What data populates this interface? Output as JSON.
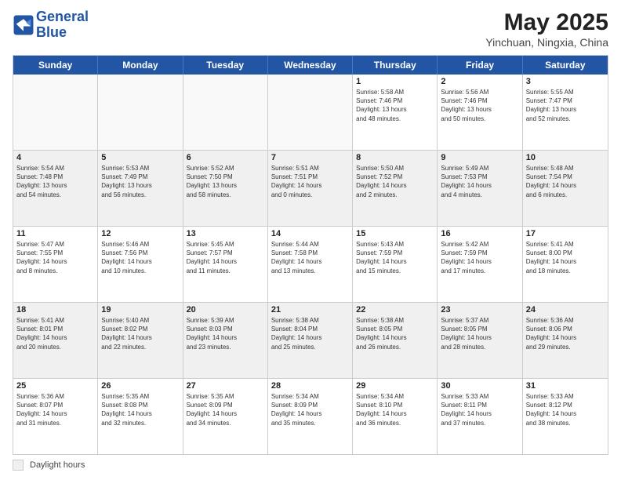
{
  "header": {
    "logo_line1": "General",
    "logo_line2": "Blue",
    "title": "May 2025",
    "subtitle": "Yinchuan, Ningxia, China"
  },
  "weekdays": [
    "Sunday",
    "Monday",
    "Tuesday",
    "Wednesday",
    "Thursday",
    "Friday",
    "Saturday"
  ],
  "legend": {
    "box_label": "Daylight hours"
  },
  "weeks": [
    [
      {
        "day": "",
        "info": "",
        "empty": true
      },
      {
        "day": "",
        "info": "",
        "empty": true
      },
      {
        "day": "",
        "info": "",
        "empty": true
      },
      {
        "day": "",
        "info": "",
        "empty": true
      },
      {
        "day": "1",
        "info": "Sunrise: 5:58 AM\nSunset: 7:46 PM\nDaylight: 13 hours\nand 48 minutes.",
        "empty": false
      },
      {
        "day": "2",
        "info": "Sunrise: 5:56 AM\nSunset: 7:46 PM\nDaylight: 13 hours\nand 50 minutes.",
        "empty": false
      },
      {
        "day": "3",
        "info": "Sunrise: 5:55 AM\nSunset: 7:47 PM\nDaylight: 13 hours\nand 52 minutes.",
        "empty": false
      }
    ],
    [
      {
        "day": "4",
        "info": "Sunrise: 5:54 AM\nSunset: 7:48 PM\nDaylight: 13 hours\nand 54 minutes.",
        "empty": false
      },
      {
        "day": "5",
        "info": "Sunrise: 5:53 AM\nSunset: 7:49 PM\nDaylight: 13 hours\nand 56 minutes.",
        "empty": false
      },
      {
        "day": "6",
        "info": "Sunrise: 5:52 AM\nSunset: 7:50 PM\nDaylight: 13 hours\nand 58 minutes.",
        "empty": false
      },
      {
        "day": "7",
        "info": "Sunrise: 5:51 AM\nSunset: 7:51 PM\nDaylight: 14 hours\nand 0 minutes.",
        "empty": false
      },
      {
        "day": "8",
        "info": "Sunrise: 5:50 AM\nSunset: 7:52 PM\nDaylight: 14 hours\nand 2 minutes.",
        "empty": false
      },
      {
        "day": "9",
        "info": "Sunrise: 5:49 AM\nSunset: 7:53 PM\nDaylight: 14 hours\nand 4 minutes.",
        "empty": false
      },
      {
        "day": "10",
        "info": "Sunrise: 5:48 AM\nSunset: 7:54 PM\nDaylight: 14 hours\nand 6 minutes.",
        "empty": false
      }
    ],
    [
      {
        "day": "11",
        "info": "Sunrise: 5:47 AM\nSunset: 7:55 PM\nDaylight: 14 hours\nand 8 minutes.",
        "empty": false
      },
      {
        "day": "12",
        "info": "Sunrise: 5:46 AM\nSunset: 7:56 PM\nDaylight: 14 hours\nand 10 minutes.",
        "empty": false
      },
      {
        "day": "13",
        "info": "Sunrise: 5:45 AM\nSunset: 7:57 PM\nDaylight: 14 hours\nand 11 minutes.",
        "empty": false
      },
      {
        "day": "14",
        "info": "Sunrise: 5:44 AM\nSunset: 7:58 PM\nDaylight: 14 hours\nand 13 minutes.",
        "empty": false
      },
      {
        "day": "15",
        "info": "Sunrise: 5:43 AM\nSunset: 7:59 PM\nDaylight: 14 hours\nand 15 minutes.",
        "empty": false
      },
      {
        "day": "16",
        "info": "Sunrise: 5:42 AM\nSunset: 7:59 PM\nDaylight: 14 hours\nand 17 minutes.",
        "empty": false
      },
      {
        "day": "17",
        "info": "Sunrise: 5:41 AM\nSunset: 8:00 PM\nDaylight: 14 hours\nand 18 minutes.",
        "empty": false
      }
    ],
    [
      {
        "day": "18",
        "info": "Sunrise: 5:41 AM\nSunset: 8:01 PM\nDaylight: 14 hours\nand 20 minutes.",
        "empty": false
      },
      {
        "day": "19",
        "info": "Sunrise: 5:40 AM\nSunset: 8:02 PM\nDaylight: 14 hours\nand 22 minutes.",
        "empty": false
      },
      {
        "day": "20",
        "info": "Sunrise: 5:39 AM\nSunset: 8:03 PM\nDaylight: 14 hours\nand 23 minutes.",
        "empty": false
      },
      {
        "day": "21",
        "info": "Sunrise: 5:38 AM\nSunset: 8:04 PM\nDaylight: 14 hours\nand 25 minutes.",
        "empty": false
      },
      {
        "day": "22",
        "info": "Sunrise: 5:38 AM\nSunset: 8:05 PM\nDaylight: 14 hours\nand 26 minutes.",
        "empty": false
      },
      {
        "day": "23",
        "info": "Sunrise: 5:37 AM\nSunset: 8:05 PM\nDaylight: 14 hours\nand 28 minutes.",
        "empty": false
      },
      {
        "day": "24",
        "info": "Sunrise: 5:36 AM\nSunset: 8:06 PM\nDaylight: 14 hours\nand 29 minutes.",
        "empty": false
      }
    ],
    [
      {
        "day": "25",
        "info": "Sunrise: 5:36 AM\nSunset: 8:07 PM\nDaylight: 14 hours\nand 31 minutes.",
        "empty": false
      },
      {
        "day": "26",
        "info": "Sunrise: 5:35 AM\nSunset: 8:08 PM\nDaylight: 14 hours\nand 32 minutes.",
        "empty": false
      },
      {
        "day": "27",
        "info": "Sunrise: 5:35 AM\nSunset: 8:09 PM\nDaylight: 14 hours\nand 34 minutes.",
        "empty": false
      },
      {
        "day": "28",
        "info": "Sunrise: 5:34 AM\nSunset: 8:09 PM\nDaylight: 14 hours\nand 35 minutes.",
        "empty": false
      },
      {
        "day": "29",
        "info": "Sunrise: 5:34 AM\nSunset: 8:10 PM\nDaylight: 14 hours\nand 36 minutes.",
        "empty": false
      },
      {
        "day": "30",
        "info": "Sunrise: 5:33 AM\nSunset: 8:11 PM\nDaylight: 14 hours\nand 37 minutes.",
        "empty": false
      },
      {
        "day": "31",
        "info": "Sunrise: 5:33 AM\nSunset: 8:12 PM\nDaylight: 14 hours\nand 38 minutes.",
        "empty": false
      }
    ]
  ]
}
